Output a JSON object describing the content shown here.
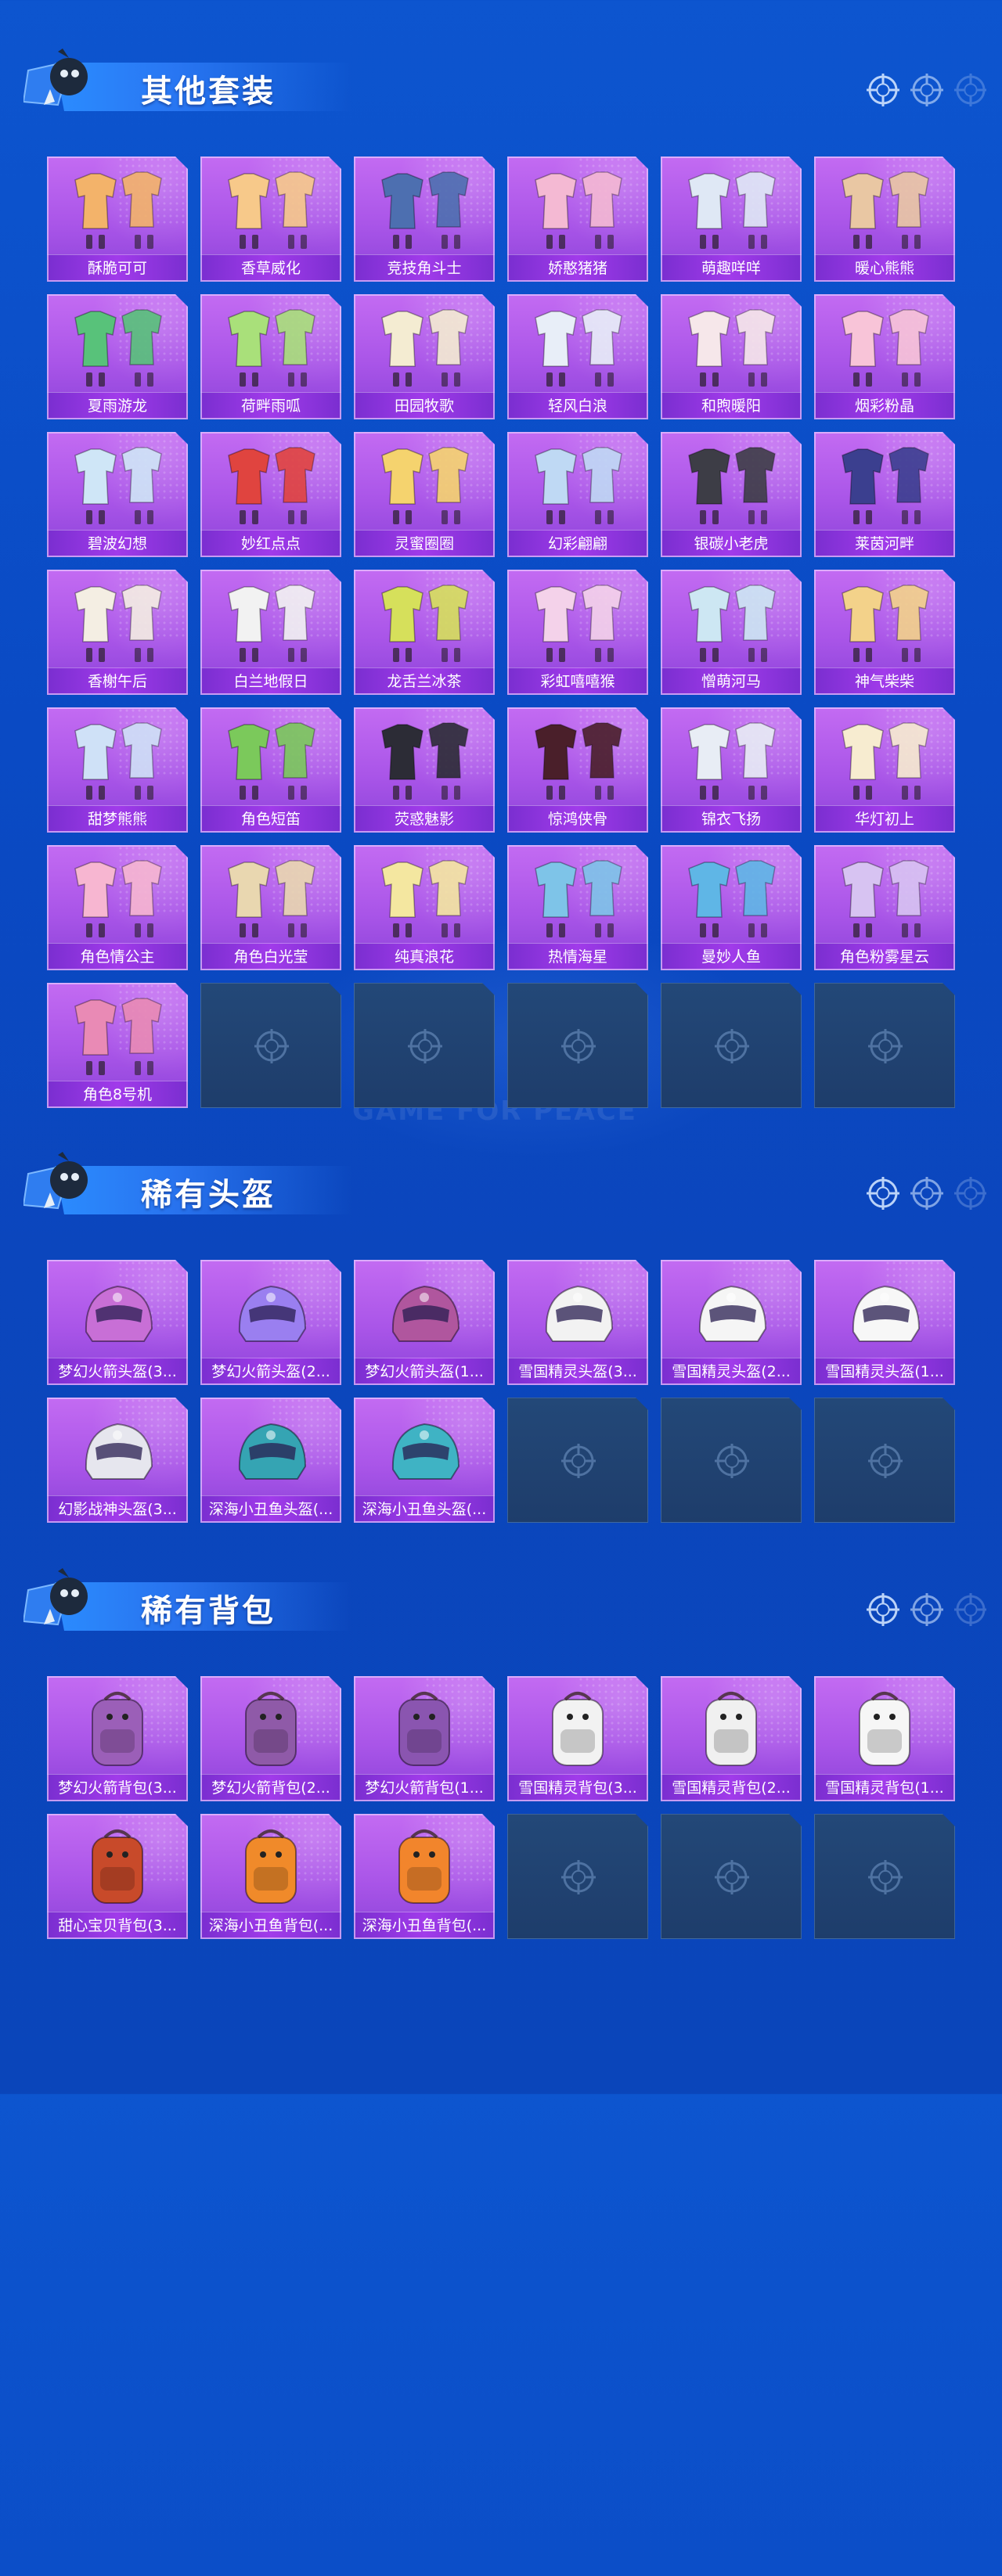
{
  "colors": {
    "background": "#0b4ec6",
    "tile_purple": "#a955e8",
    "tile_empty": "#1e3d6b",
    "caption_bar": "#8a33df"
  },
  "watermark": "GAME FOR PEACE",
  "sections": [
    {
      "title": "其他套装",
      "icon": "outfit-icon",
      "items": [
        "酥脆可可",
        "香草威化",
        "竞技角斗士",
        "娇憨猪猪",
        "萌趣咩咩",
        "暖心熊熊",
        "夏雨游龙",
        "荷畔雨呱",
        "田园牧歌",
        "轻风白浪",
        "和煦暖阳",
        "烟彩粉晶",
        "碧波幻想",
        "妙红点点",
        "灵蜜圈圈",
        "幻彩翩翩",
        "银碳小老虎",
        "莱茵河畔",
        "香榭午后",
        "白兰地假日",
        "龙舌兰冰茶",
        "彩虹嘻嘻猴",
        "憎萌河马",
        "神气柴柴",
        "甜梦熊熊",
        "角色短笛",
        "荧惑魅影",
        "惊鸿侠骨",
        "锦衣飞扬",
        "华灯初上",
        "角色情公主",
        "角色白光莹",
        "纯真浪花",
        "热情海星",
        "曼妙人鱼",
        "角色粉雾星云",
        "角色8号机"
      ],
      "empty_slots": 5
    },
    {
      "title": "稀有头盔",
      "icon": "helmet-icon",
      "items": [
        "梦幻火箭头盔(3...",
        "梦幻火箭头盔(2...",
        "梦幻火箭头盔(1...",
        "雪国精灵头盔(3...",
        "雪国精灵头盔(2...",
        "雪国精灵头盔(1...",
        "幻影战神头盔(3...",
        "深海小丑鱼头盔(...",
        "深海小丑鱼头盔(..."
      ],
      "empty_slots": 3
    },
    {
      "title": "稀有背包",
      "icon": "backpack-icon",
      "items": [
        "梦幻火箭背包(3...",
        "梦幻火箭背包(2...",
        "梦幻火箭背包(1...",
        "雪国精灵背包(3...",
        "雪国精灵背包(2...",
        "雪国精灵背包(1...",
        "甜心宝贝背包(3...",
        "深海小丑鱼背包(...",
        "深海小丑鱼背包(..."
      ],
      "empty_slots": 3
    }
  ]
}
